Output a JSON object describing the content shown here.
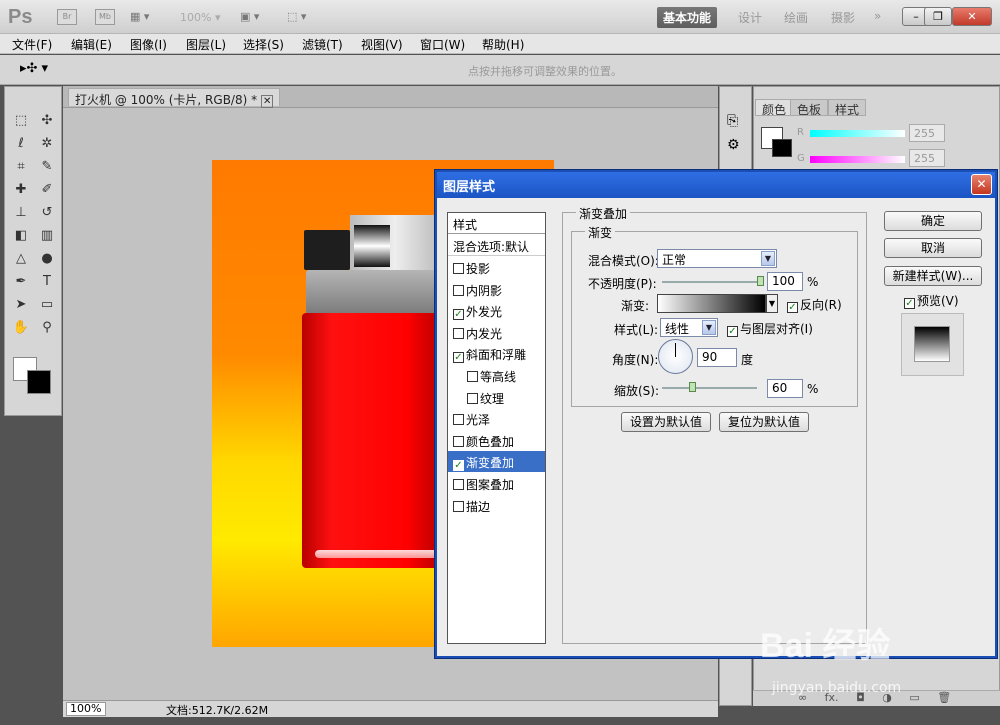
{
  "app": {
    "logo": "Ps",
    "icon_br": "Br",
    "icon_mb": "Mb",
    "zoom_display": "100%"
  },
  "workspaces": [
    "基本功能",
    "设计",
    "绘画",
    "摄影",
    "»"
  ],
  "window_buttons": {
    "minimize": "–",
    "restore": "❐",
    "close": "✕"
  },
  "menu": [
    "文件(F)",
    "编辑(E)",
    "图像(I)",
    "图层(L)",
    "选择(S)",
    "滤镜(T)",
    "视图(V)",
    "窗口(W)",
    "帮助(H)"
  ],
  "options_bar": {
    "hint": "点按并拖移可调整效果的位置。"
  },
  "document": {
    "tab_title": "打火机 @ 100% (卡片, RGB/8) *",
    "tab_close": "✕"
  },
  "status_bar": {
    "zoom": "100%",
    "doc_info": "文档:512.7K/2.62M"
  },
  "color_panel": {
    "tabs": [
      "颜色",
      "色板",
      "样式"
    ],
    "r_label": "R",
    "r_value": "255",
    "g_label": "G",
    "g_value": "255"
  },
  "dialog": {
    "title": "图层样式",
    "close": "✕",
    "styles_header": "样式",
    "blend_options": "混合选项:默认",
    "style_items": [
      {
        "label": "投影",
        "checked": false,
        "indent": false
      },
      {
        "label": "内阴影",
        "checked": false,
        "indent": false
      },
      {
        "label": "外发光",
        "checked": true,
        "indent": false
      },
      {
        "label": "内发光",
        "checked": false,
        "indent": false
      },
      {
        "label": "斜面和浮雕",
        "checked": true,
        "indent": false
      },
      {
        "label": "等高线",
        "checked": false,
        "indent": true
      },
      {
        "label": "纹理",
        "checked": false,
        "indent": true
      },
      {
        "label": "光泽",
        "checked": false,
        "indent": false
      },
      {
        "label": "颜色叠加",
        "checked": false,
        "indent": false
      },
      {
        "label": "渐变叠加",
        "checked": true,
        "indent": false,
        "selected": true
      },
      {
        "label": "图案叠加",
        "checked": false,
        "indent": false
      },
      {
        "label": "描边",
        "checked": false,
        "indent": false
      }
    ],
    "section_title": "渐变叠加",
    "group_title": "渐变",
    "blend_mode_label": "混合模式(O):",
    "blend_mode_value": "正常",
    "opacity_label": "不透明度(P):",
    "opacity_value": "100",
    "opacity_unit": "%",
    "opacity_level": 1.0,
    "gradient_label": "渐变:",
    "reverse_label": "反向(R)",
    "reverse_checked": true,
    "style_label": "样式(L):",
    "style_value": "线性",
    "align_label": "与图层对齐(I)",
    "align_checked": true,
    "angle_label": "角度(N):",
    "angle_value": "90",
    "angle_unit": "度",
    "scale_label": "缩放(S):",
    "scale_value": "60",
    "scale_unit": "%",
    "scale_level": 0.2,
    "set_default": "设置为默认值",
    "reset_default": "复位为默认值",
    "ok": "确定",
    "cancel": "取消",
    "new_style": "新建样式(W)...",
    "preview_label": "预览(V)",
    "preview_checked": true
  },
  "watermark": {
    "logo": "Bai 经验",
    "url": "jingyan.baidu.com"
  }
}
